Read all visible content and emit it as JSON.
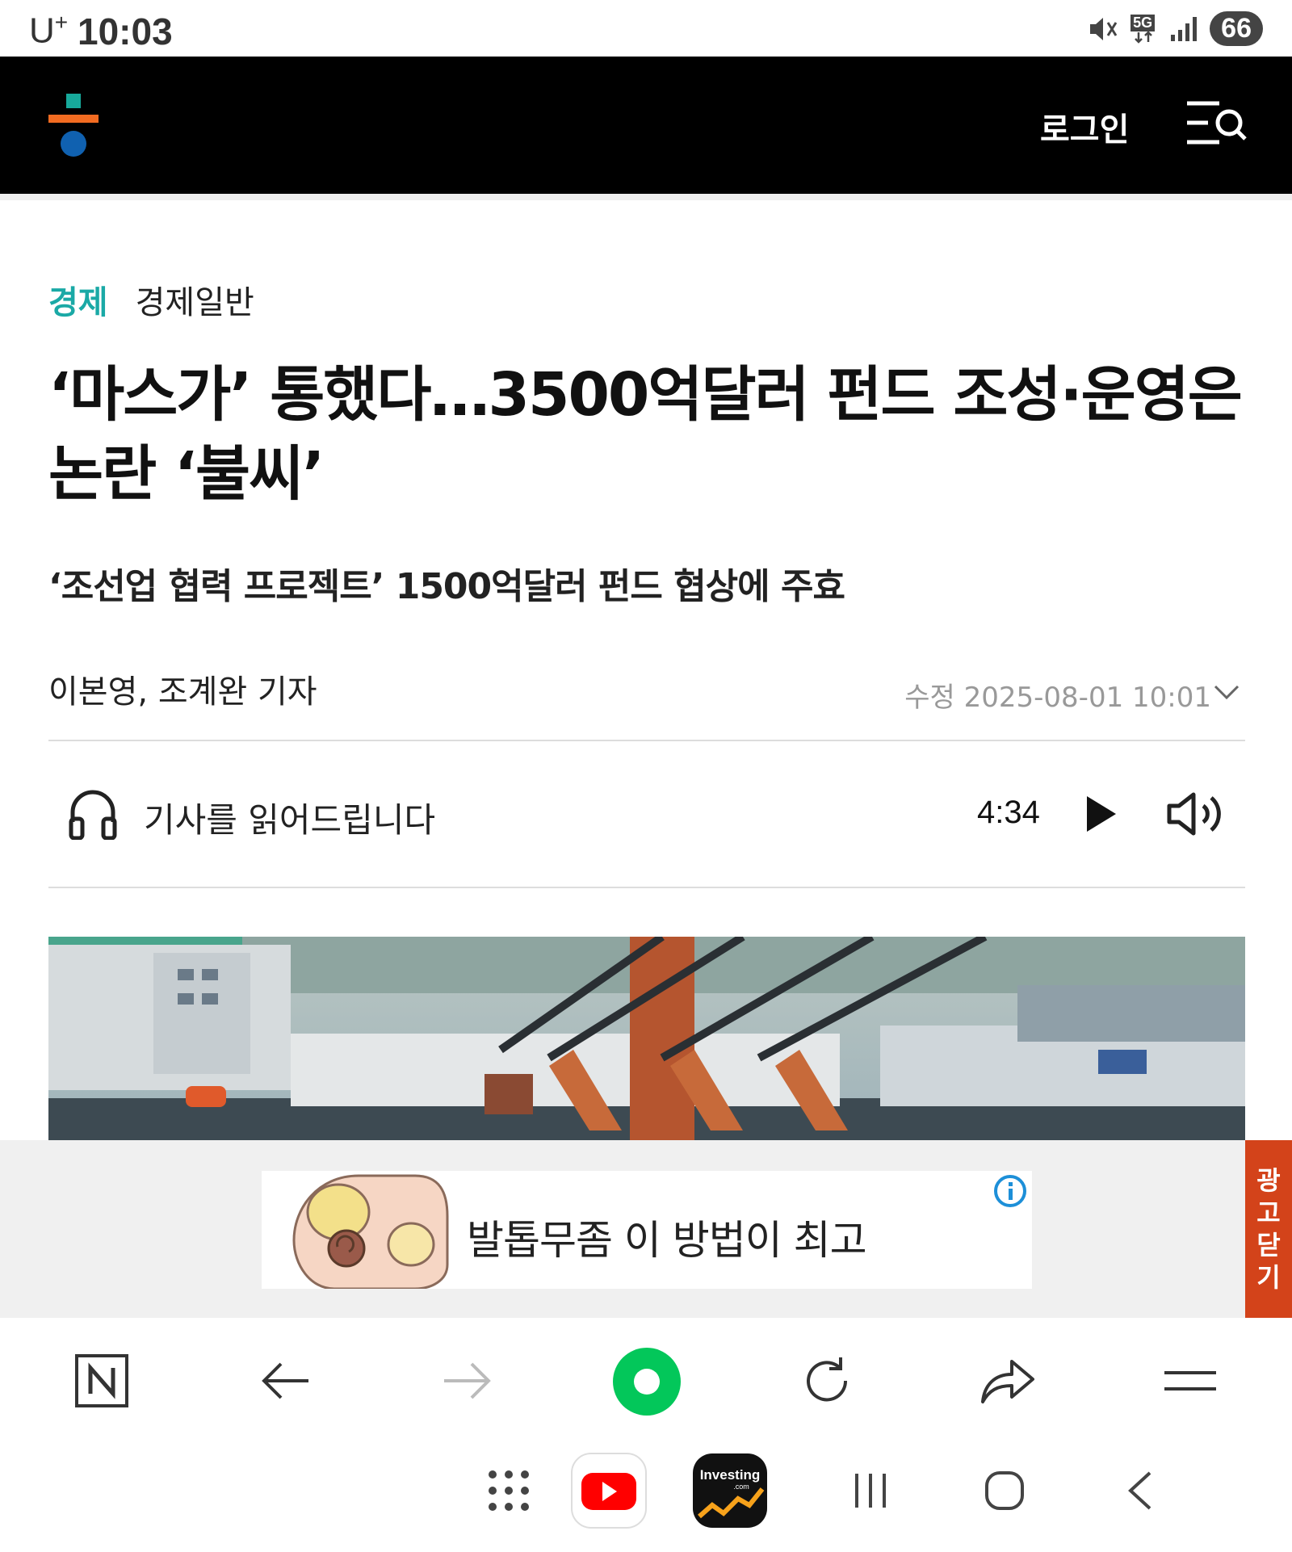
{
  "status_bar": {
    "carrier": "U",
    "carrier_sup": "+",
    "time": "10:03",
    "network": "5G",
    "battery": "66"
  },
  "header": {
    "login_label": "로그인"
  },
  "article": {
    "category_main": "경제",
    "category_sub": "경제일반",
    "headline_line1": "‘마스가’ 통했다…3500억달러 펀드 조성·운영은",
    "headline_line2": "논란 ‘불씨’",
    "subhead": "‘조선업 협력 프로젝트’ 1500억달러 펀드 협상에 주효",
    "byline": "이본영, 조계완 기자",
    "date": "수정 2025-08-01 10:01"
  },
  "audio": {
    "label": "기사를 읽어드립니다",
    "duration": "4:34"
  },
  "ad": {
    "text": "발톱무좀 이 방법이 최고",
    "close_chars": [
      "광",
      "고",
      "닫",
      "기"
    ]
  },
  "nav_apps": {
    "investing_label": "Investing",
    "investing_sub": ".com"
  },
  "colors": {
    "header_bg": "#000000",
    "category_accent": "#1aa9a6",
    "logo_teal": "#17a99b",
    "logo_orange": "#f26b21",
    "logo_blue": "#1061b0",
    "ad_close_bg": "#d3431a",
    "naver_green": "#03c75a"
  }
}
